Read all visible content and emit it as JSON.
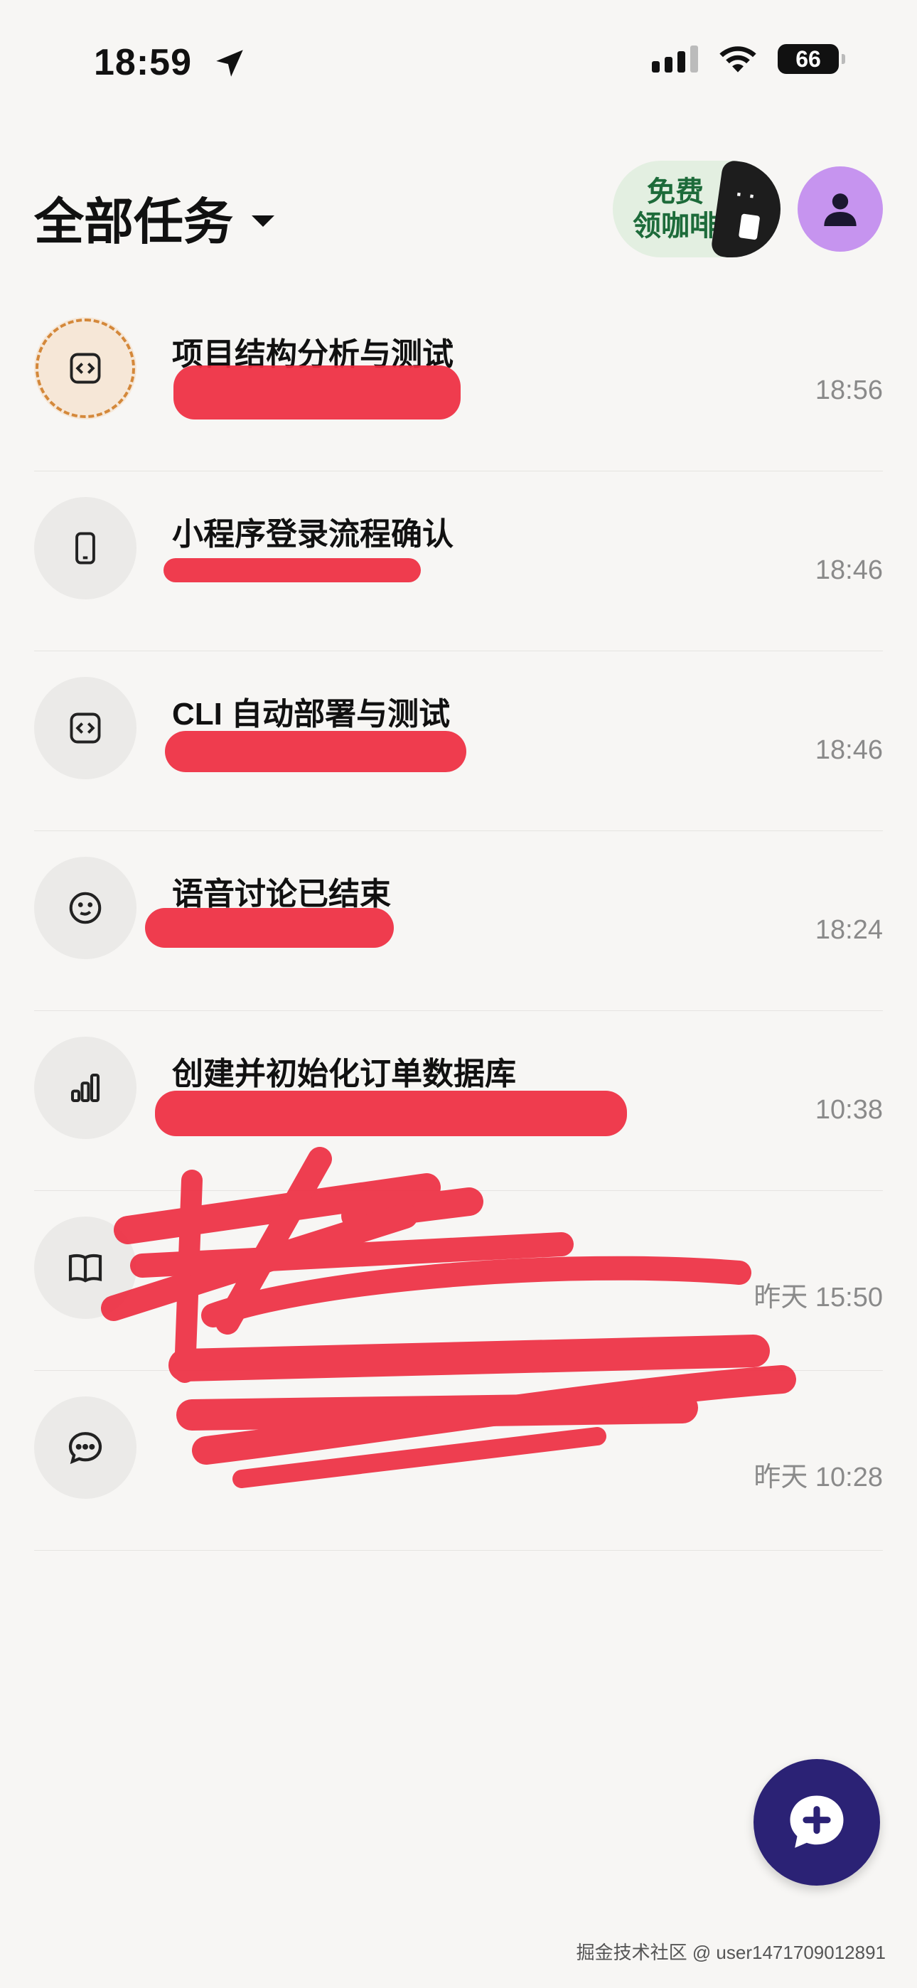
{
  "status_bar": {
    "time": "18:59",
    "battery": "66"
  },
  "header": {
    "title": "全部任务",
    "promo_text_line1": "免费",
    "promo_text_line2": "领咖啡"
  },
  "tasks": [
    {
      "title": "项目结构分析与测试",
      "time": "18:56",
      "icon": "code-icon",
      "active": true
    },
    {
      "title": "小程序登录流程确认",
      "time": "18:46",
      "icon": "phone-icon"
    },
    {
      "title": "CLI 自动部署与测试",
      "time": "18:46",
      "icon": "code-icon"
    },
    {
      "title": "语音讨论已结束",
      "time": "18:24",
      "icon": "smile-icon"
    },
    {
      "title": "创建并初始化订单数据库",
      "time": "10:38",
      "icon": "bar-chart-icon"
    },
    {
      "title": "",
      "time": "昨天 15:50",
      "icon": "book-icon"
    },
    {
      "title": "",
      "time": "昨天 10:28",
      "icon": "chat-icon"
    }
  ],
  "watermark": "掘金技术社区 @ user1471709012891",
  "colors": {
    "accent": "#2b2275",
    "avatar": "#c694ef",
    "active_ring": "#d4883a",
    "redaction": "#ee2b3f"
  }
}
